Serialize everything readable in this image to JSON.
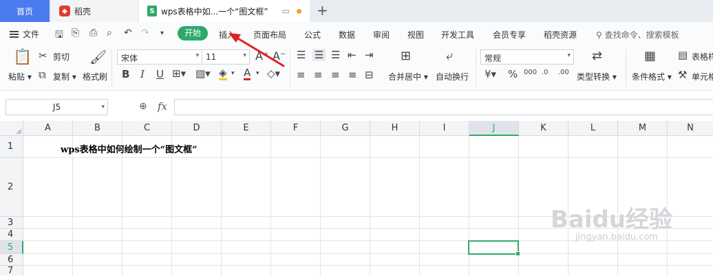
{
  "tabs": {
    "home": "首页",
    "daoke": "稻壳",
    "doc": "wps表格中如...一个“图文框”"
  },
  "menu": {
    "file": "文件",
    "start": "开始",
    "insert": "插入",
    "page_layout": "页面布局",
    "formula": "公式",
    "data": "数据",
    "review": "审阅",
    "view": "视图",
    "dev_tools": "开发工具",
    "member": "会员专享",
    "daoke_res": "稻壳资源",
    "search": "查找命令、搜索模板"
  },
  "ribbon": {
    "paste": "粘贴",
    "cut": "剪切",
    "copy": "复制",
    "format_painter": "格式刷",
    "font_name": "宋体",
    "font_size": "11",
    "merge_center": "合并居中",
    "wrap_text": "自动换行",
    "number_format": "常规",
    "type_convert": "类型转换",
    "cond_format": "条件格式",
    "table_style": "表格样",
    "cell_style": "单元格"
  },
  "formula_bar": {
    "name_box": "J5",
    "fx": "fx",
    "value": ""
  },
  "sheet": {
    "columns": [
      "A",
      "B",
      "C",
      "D",
      "E",
      "F",
      "G",
      "H",
      "I",
      "J",
      "K",
      "L",
      "M",
      "N"
    ],
    "rows": [
      "1",
      "2",
      "3",
      "4",
      "5",
      "6",
      "7"
    ],
    "selected_column": "J",
    "selected_row": "5",
    "cell_a1_text": "wps表格中如何绘制一个“图文框”"
  },
  "watermark": {
    "main": "Baidu经验",
    "sub": "jingyan.baidu.com"
  },
  "colors": {
    "accent_green": "#2ea96b",
    "home_tab_blue": "#4b7bec",
    "arrow_red": "#e02020"
  }
}
